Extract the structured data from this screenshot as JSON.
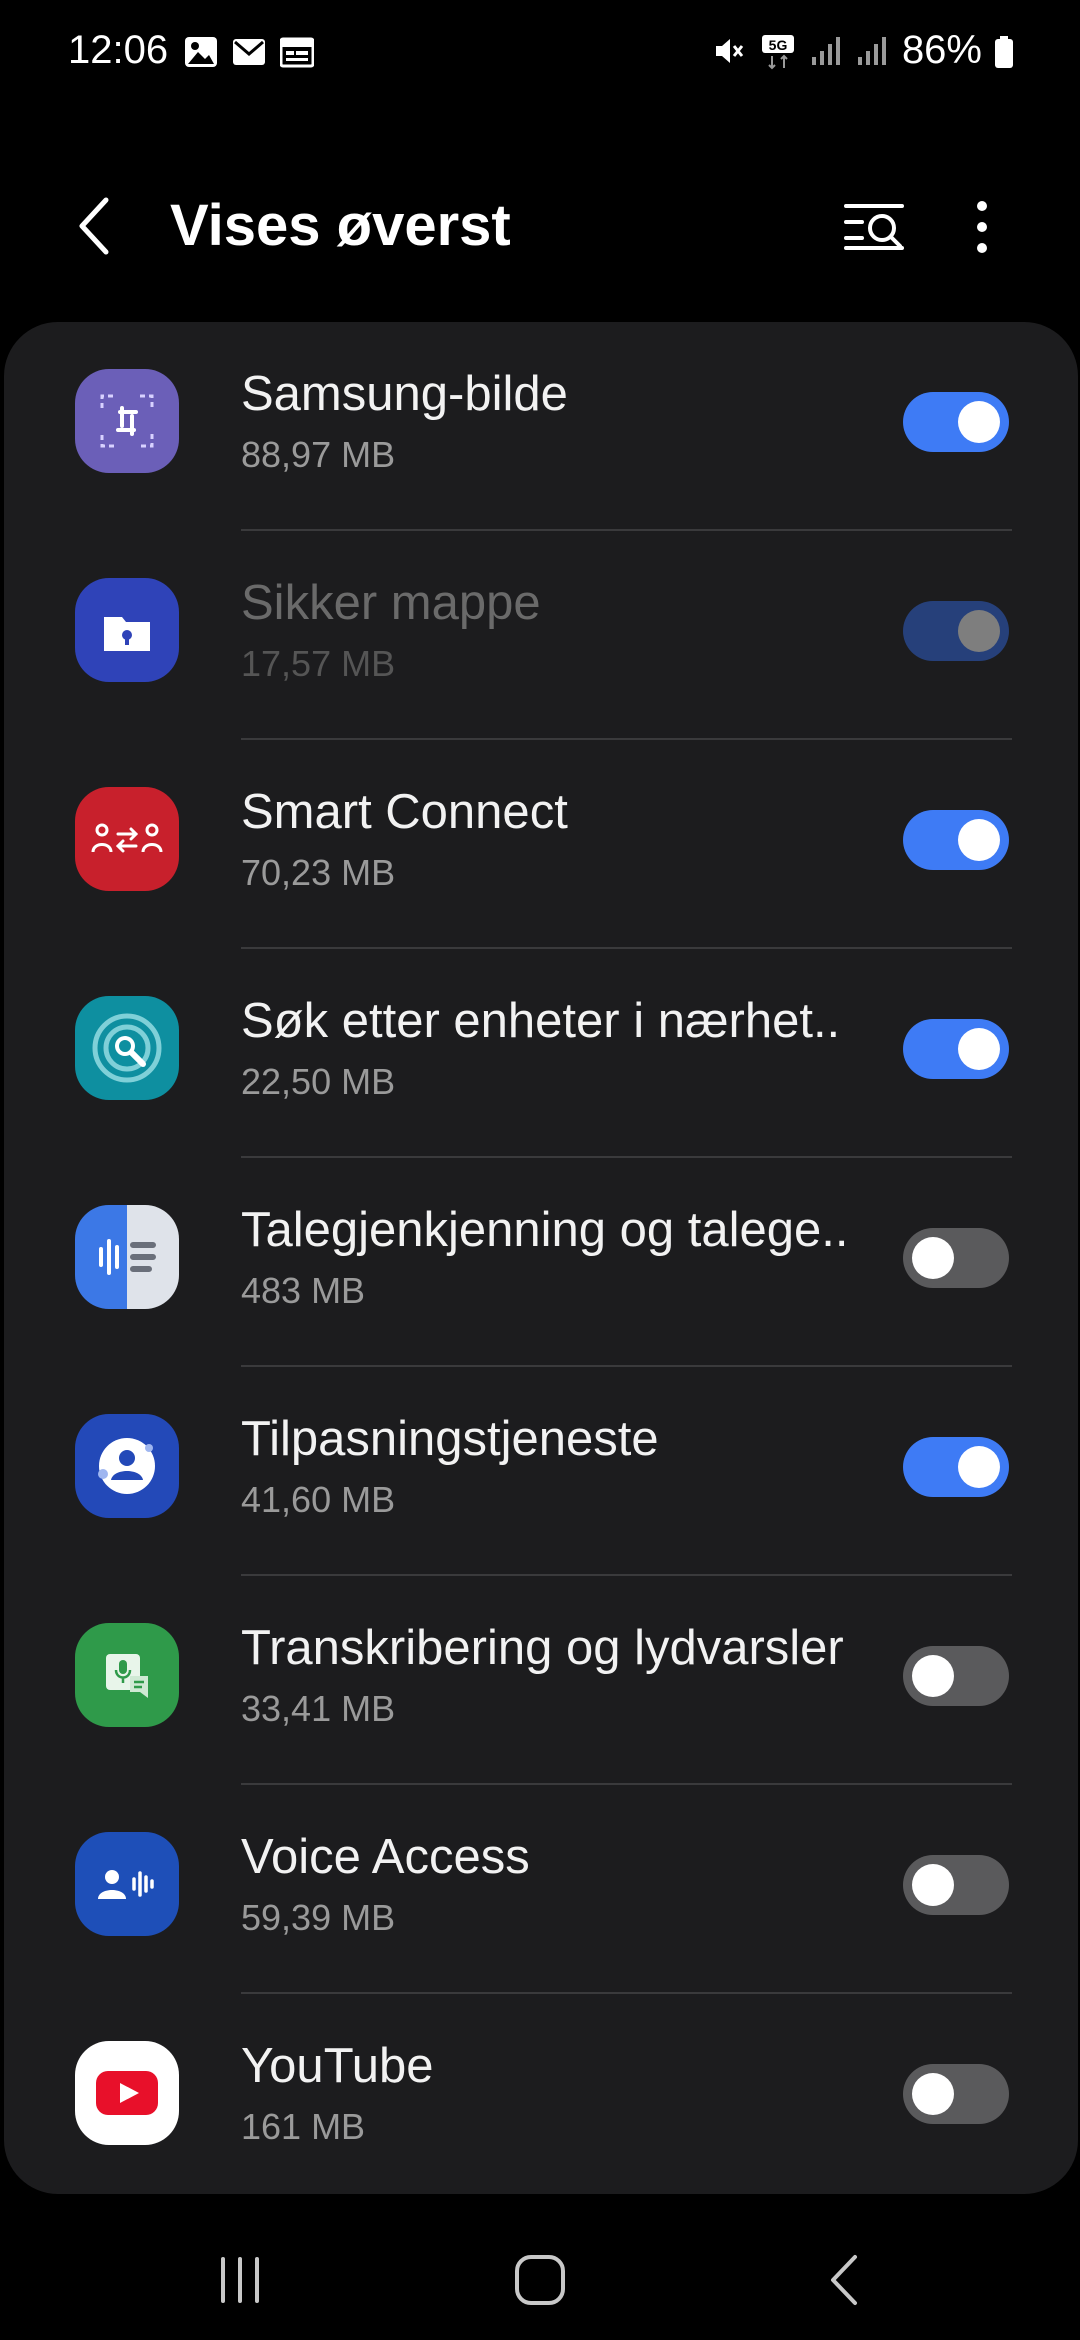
{
  "status_bar": {
    "time": "12:06",
    "battery_percent": "86%",
    "network_badge": "5G",
    "icons_left": [
      "image-icon",
      "mail-icon",
      "calendar-icon"
    ],
    "icons_right": [
      "mute-icon",
      "5g-icon",
      "signal-icon",
      "signal-icon",
      "battery-icon"
    ]
  },
  "header": {
    "title": "Vises øverst",
    "back_icon": "chevron-left-icon",
    "search_icon": "filter-search-icon",
    "more_icon": "more-vertical-icon"
  },
  "apps": [
    {
      "name": "Samsung-bilde",
      "size": "88,97 MB",
      "enabled": true,
      "disabled_row": false,
      "icon": "samsung-capture-icon",
      "icon_color": "#6b5fb8"
    },
    {
      "name": "Sikker mappe",
      "size": "17,57 MB",
      "enabled": true,
      "disabled_row": true,
      "icon": "secure-folder-icon",
      "icon_color": "#2f43b8"
    },
    {
      "name": "Smart Connect",
      "size": "70,23 MB",
      "enabled": true,
      "disabled_row": false,
      "icon": "smart-connect-icon",
      "icon_color": "#c8202c"
    },
    {
      "name": "Søk etter enheter i nærhet..",
      "size": "22,50 MB",
      "enabled": true,
      "disabled_row": false,
      "icon": "nearby-scan-icon",
      "icon_color": "#0e8fa0"
    },
    {
      "name": "Talegjenkjenning og talege..",
      "size": "483 MB",
      "enabled": false,
      "disabled_row": false,
      "icon": "speech-services-icon",
      "icon_color": "#3c78e6"
    },
    {
      "name": "Tilpasningstjeneste",
      "size": "41,60 MB",
      "enabled": true,
      "disabled_row": false,
      "icon": "customization-service-icon",
      "icon_color": "#2349b8"
    },
    {
      "name": "Transkribering og lydvarsler",
      "size": "33,41 MB",
      "enabled": false,
      "disabled_row": false,
      "icon": "live-transcribe-icon",
      "icon_color": "#2f9a4a"
    },
    {
      "name": "Voice Access",
      "size": "59,39 MB",
      "enabled": false,
      "disabled_row": false,
      "icon": "voice-access-icon",
      "icon_color": "#1e4fb8"
    },
    {
      "name": "YouTube",
      "size": "161 MB",
      "enabled": false,
      "disabled_row": false,
      "icon": "youtube-icon",
      "icon_color": "#ffffff"
    }
  ],
  "navbar": {
    "recents_icon": "recents-icon",
    "home_icon": "home-icon",
    "back_icon": "back-icon"
  }
}
